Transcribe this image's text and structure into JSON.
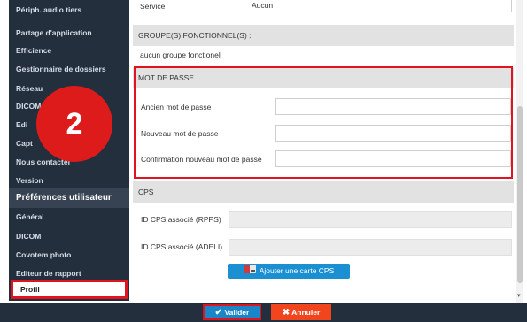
{
  "sidebar": {
    "items": [
      {
        "label": "Périph. audio tiers"
      },
      {
        "label": "Partage d'application"
      },
      {
        "label": "Efficience"
      },
      {
        "label": "Gestionnaire de dossiers"
      },
      {
        "label": "Réseau"
      },
      {
        "label": "DICOM"
      },
      {
        "label": "Edi"
      },
      {
        "label": "Capt"
      },
      {
        "label": "Nous contacter"
      },
      {
        "label": "Version"
      }
    ],
    "section_title": "Préférences utilisateur",
    "user_items": [
      {
        "label": "Général"
      },
      {
        "label": "DICOM"
      },
      {
        "label": "Covotem photo"
      },
      {
        "label": "Editeur de rapport"
      },
      {
        "label": "Profil"
      }
    ]
  },
  "badge": {
    "number": "2"
  },
  "form": {
    "service_label": "Service",
    "service_value": "Aucun",
    "groupes_title": "GROUPE(S) FONCTIONNEL(S) :",
    "groupes_value": "aucun groupe fonctionel",
    "password_section": "MOT DE PASSE",
    "old_password_label": "Ancien mot de passe",
    "new_password_label": "Nouveau mot de passe",
    "confirm_password_label": "Confirmation nouveau mot de passe",
    "cps_section": "CPS",
    "cps_rpps_label": "ID CPS associé (RPPS)",
    "cps_adeli_label": "ID CPS associé (ADELI)",
    "add_cps_button": "Ajouter une carte CPS"
  },
  "footer": {
    "valider_label": "Valider",
    "annuler_label": "Annuler"
  },
  "colors": {
    "sidebar_bg": "#242f3e",
    "highlight_red": "#e0141e",
    "valider_blue": "#1a86c8",
    "annuler_orange": "#f0451d"
  }
}
